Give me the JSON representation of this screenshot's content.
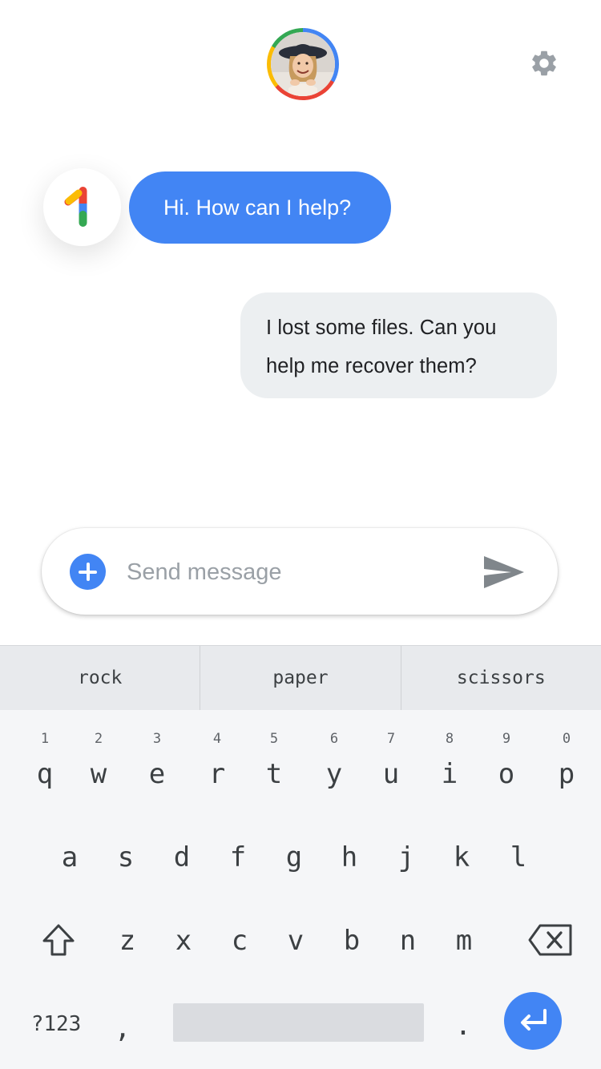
{
  "header": {
    "avatar_icon": "user-avatar",
    "settings_icon": "gear-icon"
  },
  "chat": {
    "bot_logo_icon": "google-one-logo",
    "messages": [
      {
        "from": "bot",
        "text": "Hi. How can I help?"
      },
      {
        "from": "user",
        "line1": "I lost some files. Can you",
        "line2": "help me recover them?"
      }
    ]
  },
  "composer": {
    "placeholder": "Send message",
    "value": "",
    "add_icon": "plus-icon",
    "send_icon": "send-icon"
  },
  "keyboard": {
    "suggestions": [
      "rock",
      "paper",
      "scissors"
    ],
    "row1_hints": [
      "1",
      "2",
      "3",
      "4",
      "5",
      "6",
      "7",
      "8",
      "9",
      "0"
    ],
    "row1": [
      "q",
      "w",
      "e",
      "r",
      "t",
      "y",
      "u",
      "i",
      "o",
      "p"
    ],
    "row2": [
      "a",
      "s",
      "d",
      "f",
      "g",
      "h",
      "j",
      "k",
      "l"
    ],
    "row3": [
      "z",
      "x",
      "c",
      "v",
      "b",
      "n",
      "m"
    ],
    "symbols_label": "?123",
    "comma": ",",
    "period": ".",
    "shift_icon": "shift-icon",
    "backspace_icon": "backspace-icon",
    "enter_icon": "enter-icon"
  },
  "colors": {
    "accent": "#4285f4",
    "bubble_user": "#eceff1",
    "keyboard_bg": "#f5f6f8",
    "suggestion_bar": "#e8eaed"
  }
}
